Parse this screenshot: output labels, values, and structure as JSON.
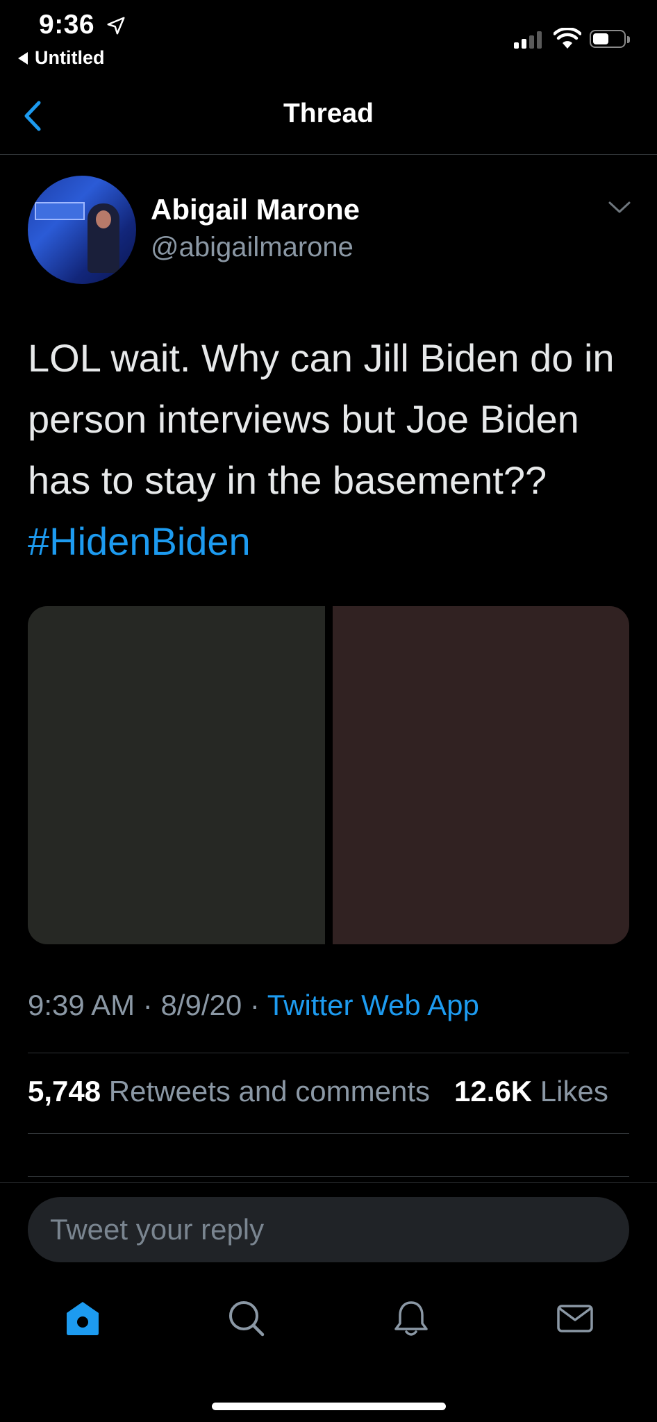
{
  "status_bar": {
    "time": "9:36",
    "back_app": "Untitled"
  },
  "nav": {
    "title": "Thread"
  },
  "tweet": {
    "author_name": "Abigail Marone",
    "author_handle": "@abigailmarone",
    "text": "LOL wait. Why can Jill Biden do in person interviews but Joe Biden has to stay in the basement?? ",
    "hashtag": "#HidenBiden",
    "time": "9:39 AM",
    "date": "8/9/20",
    "separator": " · ",
    "source": "Twitter Web App",
    "retweets_count": "5,748",
    "retweets_label": "Retweets and comments",
    "likes_count": "12.6K",
    "likes_label": "Likes"
  },
  "reply": {
    "placeholder": "Tweet your reply"
  },
  "colors": {
    "accent": "#1d9bf0",
    "background": "#000000",
    "secondary_text": "#8b98a5"
  },
  "tabs": [
    "home-icon",
    "search-icon",
    "notifications-icon",
    "messages-icon"
  ]
}
